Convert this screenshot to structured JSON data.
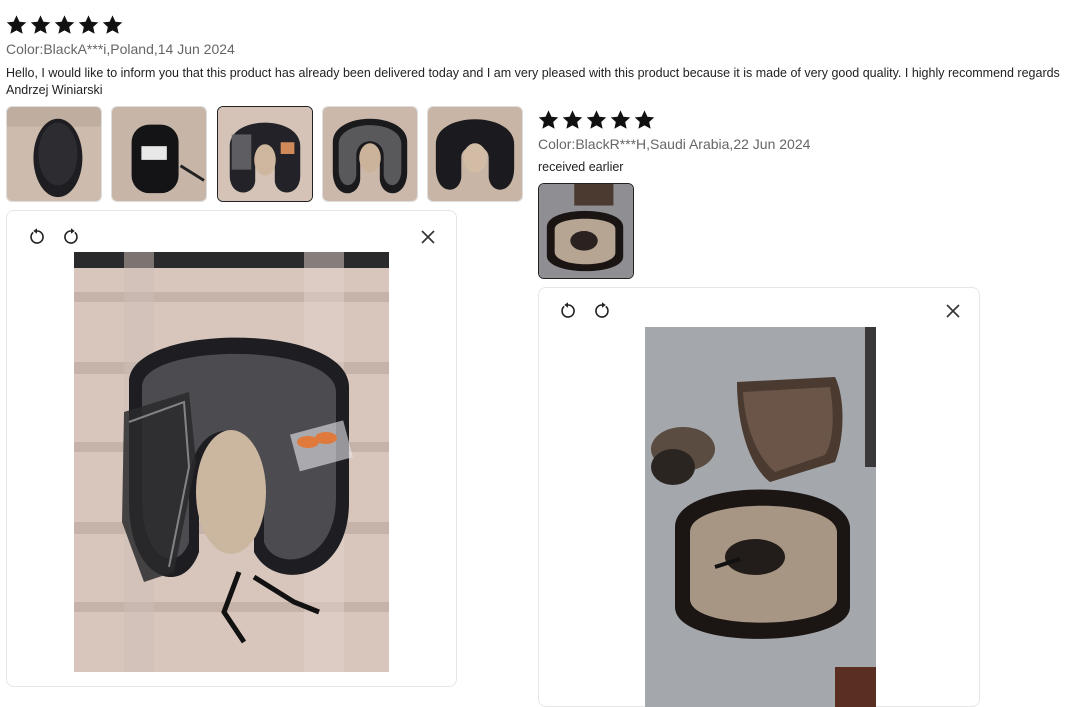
{
  "reviews": [
    {
      "rating": 5,
      "meta": "Color:BlackA***i,Poland,14 Jun 2024",
      "text": "Hello, I would like to inform you that this product has already been delivered today and I am very pleased with this product because it is made of very good quality. I highly recommend regards Andrzej Winiarski",
      "thumbnails": [
        "photo-1",
        "photo-2",
        "photo-3",
        "photo-4",
        "photo-5"
      ],
      "selected_thumbnail": 3
    },
    {
      "rating": 5,
      "meta": "Color:BlackR***H,Saudi Arabia,22 Jun 2024",
      "text": "received earlier",
      "thumbnails": [
        "photo-1"
      ],
      "selected_thumbnail": 1
    }
  ],
  "icons": {
    "star": "star-icon",
    "rotate_left": "rotate-left-icon",
    "rotate_right": "rotate-right-icon",
    "close": "close-icon"
  },
  "colors": {
    "star": "#111111",
    "meta_text": "#666666",
    "border": "#e6e6e6"
  }
}
